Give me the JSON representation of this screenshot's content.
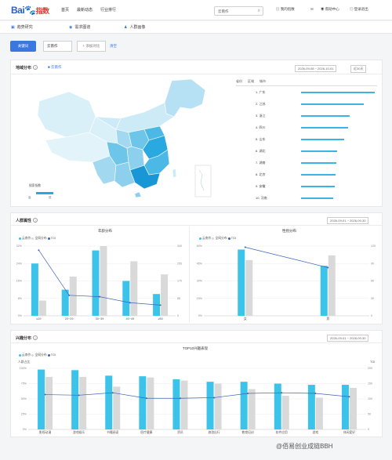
{
  "header": {
    "logo_main": "Bai",
    "logo_paw": "🐾",
    "logo_sub": "指数",
    "nav": [
      "首页",
      "最新动态",
      "行业排行"
    ],
    "search_value": "云南作",
    "top_right": [
      "我的指数",
      "帮助中心",
      "登录退出"
    ]
  },
  "subnav": {
    "items": [
      "趋势研究",
      "需求图谱",
      "人群画像"
    ]
  },
  "keywords": {
    "button": "关键词",
    "input_value": "云南作",
    "add_compare": "+ 添加对比",
    "clear": "清空"
  },
  "region_card": {
    "title": "地域分布",
    "keyword_tag": "云南作",
    "date_range": "2026-09-08 ~ 2026-10-01",
    "period": "近30天",
    "table_headers": [
      "省份",
      "区域",
      "城市"
    ],
    "map_legend_title": "搜索指数",
    "map_legend_range": [
      "高",
      "低"
    ],
    "ranking": [
      {
        "rank": "1.",
        "name": "广东",
        "value": 96
      },
      {
        "rank": "2.",
        "name": "江苏",
        "value": 82
      },
      {
        "rank": "3.",
        "name": "浙江",
        "value": 63
      },
      {
        "rank": "4.",
        "name": "四川",
        "value": 61
      },
      {
        "rank": "5.",
        "name": "山东",
        "value": 56
      },
      {
        "rank": "6.",
        "name": "湖北",
        "value": 47
      },
      {
        "rank": "7.",
        "name": "湖南",
        "value": 46
      },
      {
        "rank": "8.",
        "name": "北京",
        "value": 45
      },
      {
        "rank": "9.",
        "name": "安徽",
        "value": 44
      },
      {
        "rank": "10.",
        "name": "河南",
        "value": 42
      }
    ]
  },
  "crowd_card": {
    "title": "人群属性",
    "date_range": "2026-09-01 ~ 2026-09-30",
    "age_title": "年龄分布",
    "gender_title": "性别分布",
    "legend": [
      "云南作",
      "全网分布",
      "TGI"
    ]
  },
  "interest_card": {
    "title": "兴趣分布",
    "date_range": "2026-09-01 ~ 2026-09-30",
    "chart_title": "TOP10兴趣表现",
    "legend": [
      "云南作",
      "全网分布",
      "TGI"
    ],
    "ylabel_left": "人群占比",
    "ylabel_right": "TGI"
  },
  "colors": {
    "primary": "#3a77e0",
    "keyword_bar": "#3cc3ea",
    "all_net_bar": "#d9d9d9",
    "tgi_line": "#3a63b8"
  },
  "chart_data": [
    {
      "type": "bar",
      "title": "年龄分布",
      "categories": [
        "≤19",
        "20~29",
        "30~39",
        "40~49",
        "≥50"
      ],
      "series": [
        {
          "name": "云南作",
          "values": [
            24,
            12,
            30,
            16,
            10
          ]
        },
        {
          "name": "全网分布",
          "values": [
            7,
            18,
            32,
            25,
            19
          ]
        },
        {
          "name": "TGI",
          "values": [
            320,
            100,
            93,
            64,
            52
          ]
        }
      ],
      "y_ticks": [
        "0%",
        "8%",
        "16%",
        "24%",
        "32%"
      ],
      "y2_ticks": [
        "0",
        "85",
        "170",
        "255",
        "340"
      ],
      "ylim": [
        0,
        32
      ],
      "y2lim": [
        0,
        340
      ]
    },
    {
      "type": "bar",
      "title": "性别分布",
      "categories": [
        "女",
        "男"
      ],
      "series": [
        {
          "name": "云南作",
          "values": [
            57,
            43
          ]
        },
        {
          "name": "全网分布",
          "values": [
            48,
            52
          ]
        },
        {
          "name": "TGI",
          "values": [
            118,
            83
          ]
        }
      ],
      "y_ticks": [
        "0%",
        "15%",
        "30%",
        "45%",
        "60%"
      ],
      "y2_ticks": [
        "0",
        "30",
        "60",
        "90",
        "120"
      ],
      "ylim": [
        0,
        60
      ],
      "y2lim": [
        0,
        120
      ]
    },
    {
      "type": "bar",
      "title": "TOP10兴趣表现",
      "categories": [
        "影视动漫",
        "游戏娱乐",
        "书籍阅读",
        "医疗健康",
        "资讯",
        "旅游出行",
        "教育培训",
        "软件应用",
        "游戏",
        "休闲爱好"
      ],
      "series": [
        {
          "name": "云南作",
          "values": [
            98,
            97,
            88,
            87,
            82,
            78,
            78,
            75,
            73,
            73
          ]
        },
        {
          "name": "全网分布",
          "values": [
            86,
            86,
            70,
            85,
            80,
            75,
            66,
            55,
            52,
            68
          ]
        },
        {
          "name": "TGI",
          "values": [
            114,
            112,
            120,
            102,
            102,
            104,
            118,
            120,
            118,
            107
          ]
        }
      ],
      "y_ticks": [
        "0%",
        "25%",
        "50%",
        "75%",
        "100%"
      ],
      "y2_ticks": [
        "0",
        "50",
        "100",
        "150",
        "200"
      ],
      "ylim": [
        0,
        100
      ],
      "y2lim": [
        0,
        200
      ]
    }
  ],
  "watermark": "@佰易创业成链BBH"
}
